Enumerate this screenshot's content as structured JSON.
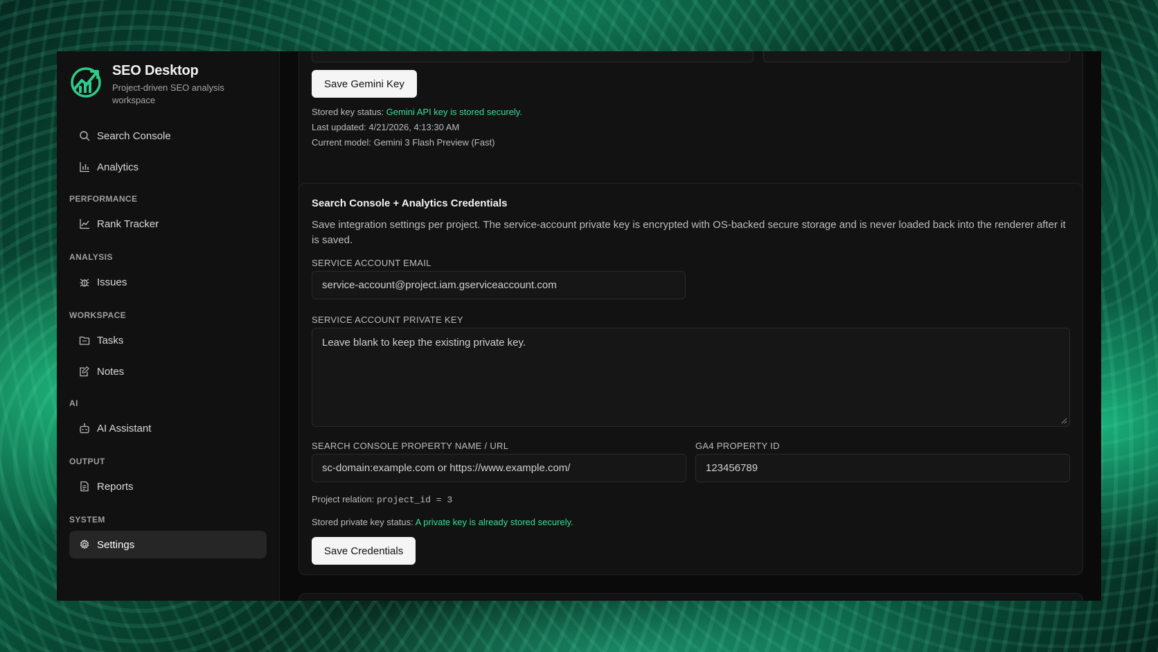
{
  "app": {
    "title": "SEO Desktop",
    "subtitle": "Project-driven SEO analysis workspace"
  },
  "sidebar": {
    "top_items": [
      {
        "label": "Search Console",
        "icon": "search-icon"
      },
      {
        "label": "Analytics",
        "icon": "bar-chart-icon"
      }
    ],
    "sections": [
      {
        "label": "PERFORMANCE",
        "items": [
          {
            "label": "Rank Tracker",
            "icon": "line-chart-icon"
          }
        ]
      },
      {
        "label": "ANALYSIS",
        "items": [
          {
            "label": "Issues",
            "icon": "bug-icon"
          }
        ]
      },
      {
        "label": "WORKSPACE",
        "items": [
          {
            "label": "Tasks",
            "icon": "folder-icon"
          },
          {
            "label": "Notes",
            "icon": "edit-note-icon"
          }
        ]
      },
      {
        "label": "AI",
        "items": [
          {
            "label": "AI Assistant",
            "icon": "bot-icon"
          }
        ]
      },
      {
        "label": "OUTPUT",
        "items": [
          {
            "label": "Reports",
            "icon": "file-text-icon"
          }
        ]
      },
      {
        "label": "SYSTEM",
        "items": [
          {
            "label": "Settings",
            "icon": "gear-icon",
            "active": true
          }
        ]
      }
    ]
  },
  "gemini": {
    "save_label": "Save Gemini Key",
    "status_prefix": "Stored key status: ",
    "status_value": "Gemini API key is stored securely.",
    "last_updated": "Last updated: 4/21/2026, 4:13:30 AM",
    "current_model": "Current model: Gemini 3 Flash Preview (Fast)"
  },
  "credentials": {
    "title": "Search Console + Analytics Credentials",
    "description": "Save integration settings per project. The service-account private key is encrypted with OS-backed secure storage and is never loaded back into the renderer after it is saved.",
    "email_label": "SERVICE ACCOUNT EMAIL",
    "email_placeholder": "service-account@project.iam.gserviceaccount.com",
    "private_key_label": "SERVICE ACCOUNT PRIVATE KEY",
    "private_key_placeholder": "Leave blank to keep the existing private key.",
    "property_label": "SEARCH CONSOLE PROPERTY NAME / URL",
    "property_placeholder": "sc-domain:example.com or https://www.example.com/",
    "ga4_label": "GA4 PROPERTY ID",
    "ga4_placeholder": "123456789",
    "relation_prefix": "Project relation: ",
    "relation_value": "project_id = 3",
    "key_status_prefix": "Stored private key status: ",
    "key_status_value": "A private key is already stored securely.",
    "save_label": "Save Credentials"
  },
  "colors": {
    "accent": "#3ddc97",
    "background": "#0a0a0a",
    "sidebar": "#111111",
    "card": "#121212"
  }
}
